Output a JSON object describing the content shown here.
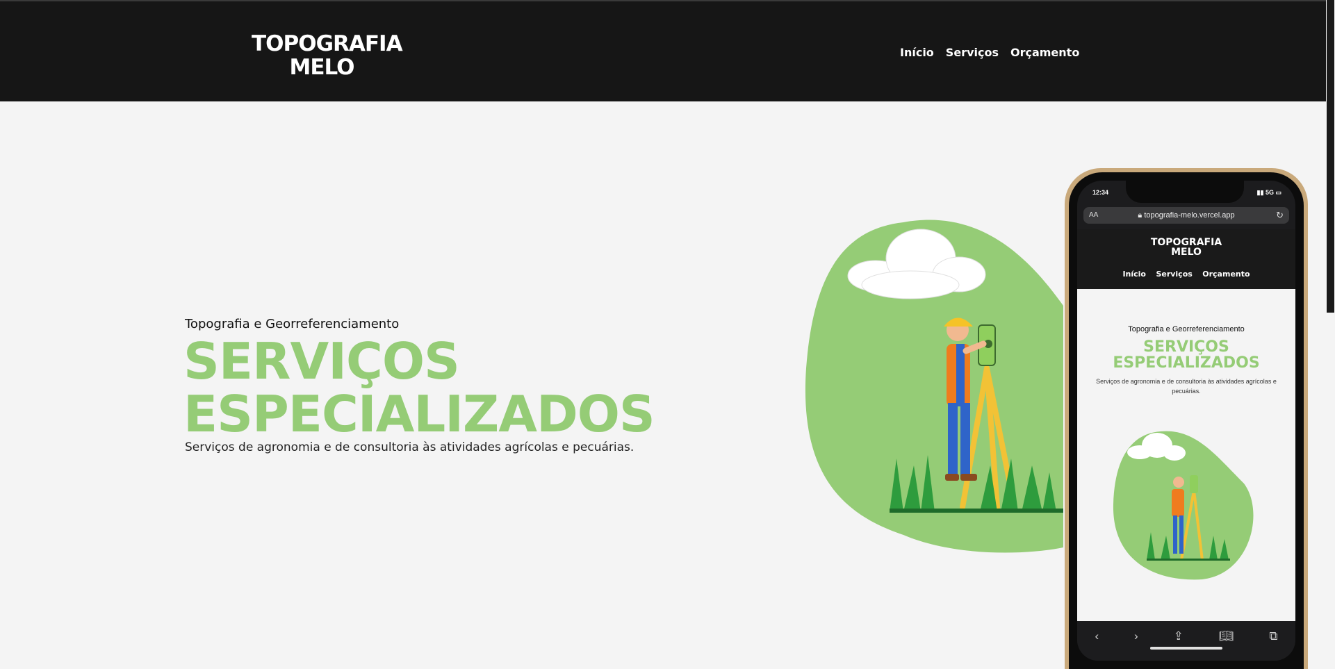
{
  "header": {
    "logo_line1": "TOPOGRAFIA",
    "logo_line2": "MELO",
    "nav": [
      "Início",
      "Serviços",
      "Orçamento"
    ]
  },
  "hero": {
    "subtitle": "Topografia e Georreferenciamento",
    "title_line1": "SERVIÇOS",
    "title_line2": "ESPECIALIZADOS",
    "description": "Serviços de agronomia e de consultoria às atividades agrícolas e pecuárias."
  },
  "phone": {
    "time": "12:34",
    "network": "5G",
    "url_aa": "AA",
    "url": "topografia-melo.vercel.app",
    "logo_line1": "TOPOGRAFIA",
    "logo_line2": "MELO",
    "nav": [
      "Início",
      "Serviços",
      "Orçamento"
    ],
    "subtitle": "Topografia e Georreferenciamento",
    "title_line1": "SERVIÇOS",
    "title_line2": "ESPECIALIZADOS",
    "description": "Serviços de agronomia e de consultoria às atividades agrícolas e pecuárias."
  },
  "colors": {
    "header_bg": "#161616",
    "page_bg": "#f4f4f4",
    "accent_green": "#95cc76",
    "phone_frame": "#c9a97b"
  },
  "icons": [
    "lock-icon",
    "reload-icon",
    "back-icon",
    "forward-icon",
    "share-icon",
    "bookmarks-icon",
    "tabs-icon"
  ]
}
